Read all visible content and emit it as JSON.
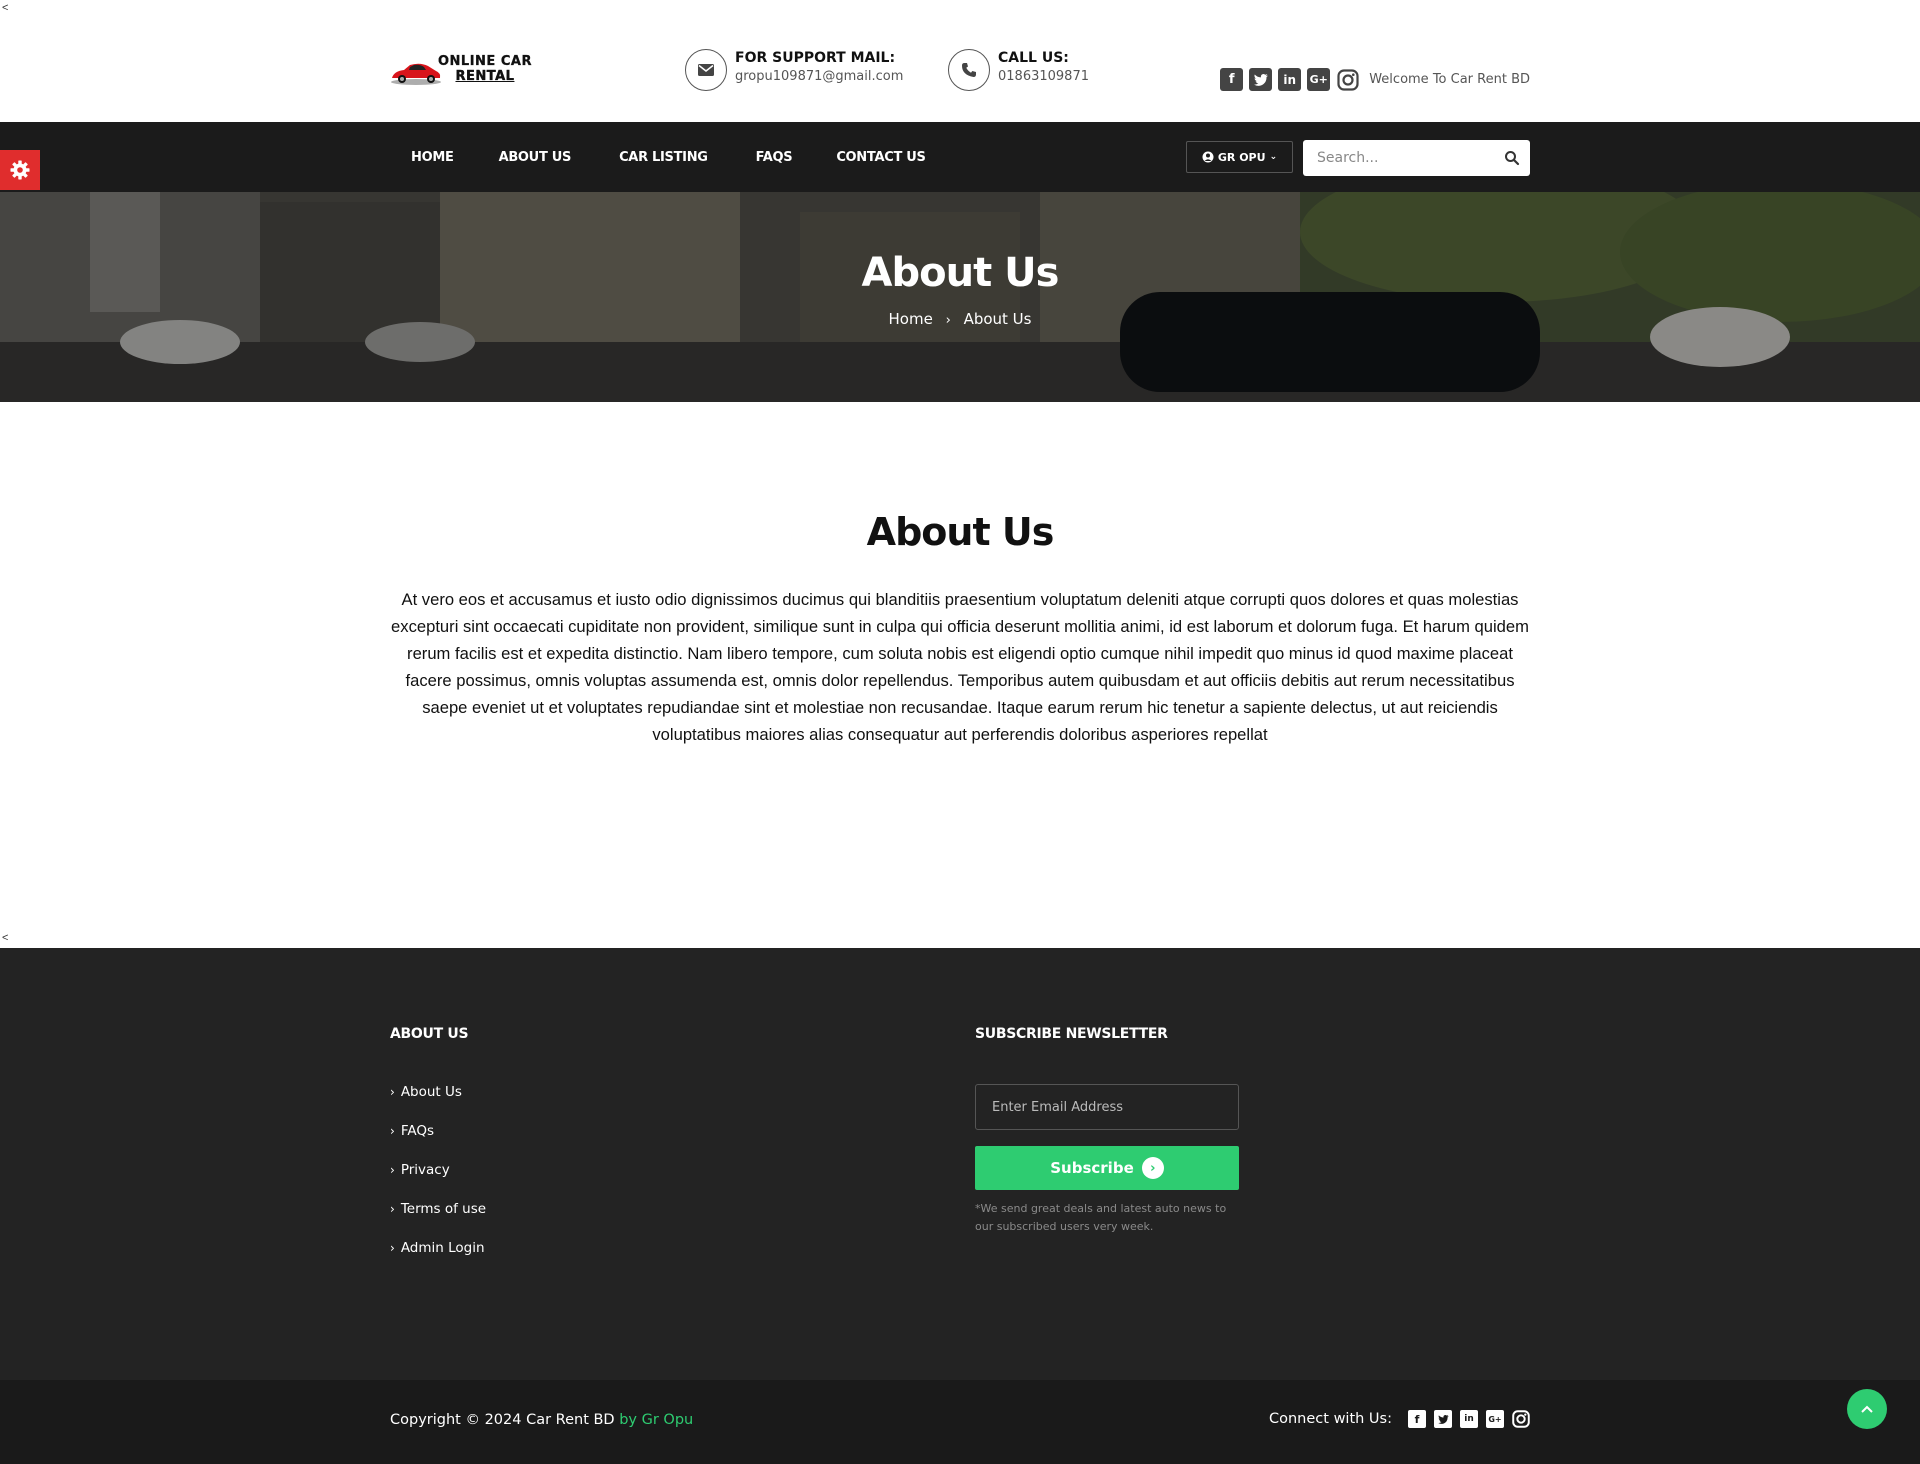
{
  "header": {
    "logo_line1": "ONLINE CAR",
    "logo_line2": "RENTAL",
    "support_label": "FOR SUPPORT MAIL:",
    "support_email": "gropu109871@gmail.com",
    "call_label": "CALL US:",
    "call_number": "01863109871",
    "social_icons": [
      "facebook-icon",
      "twitter-icon",
      "linkedin-icon",
      "google-plus-icon",
      "instagram-icon"
    ],
    "welcome": "Welcome To Car Rent BD"
  },
  "stray_glyph": "<",
  "nav": {
    "items": [
      {
        "label": "HOME"
      },
      {
        "label": "ABOUT US"
      },
      {
        "label": "CAR LISTING"
      },
      {
        "label": "FAQS"
      },
      {
        "label": "CONTACT US"
      }
    ],
    "user_label": "GR OPU",
    "search_placeholder": "Search..."
  },
  "banner": {
    "title": "About Us",
    "crumb_home": "Home",
    "crumb_current": "About Us"
  },
  "about": {
    "title": "About Us",
    "text": "At vero eos et accusamus et iusto odio dignissimos ducimus qui blanditiis praesentium voluptatum deleniti atque corrupti quos dolores et quas molestias excepturi sint occaecati cupiditate non provident, similique sunt in culpa qui officia deserunt mollitia animi, id est laborum et dolorum fuga. Et harum quidem rerum facilis est et expedita distinctio. Nam libero tempore, cum soluta nobis est eligendi optio cumque nihil impedit quo minus id quod maxime placeat facere possimus, omnis voluptas assumenda est, omnis dolor repellendus. Temporibus autem quibusdam et aut officiis debitis aut rerum necessitatibus saepe eveniet ut et voluptates repudiandae sint et molestiae non recusandae. Itaque earum rerum hic tenetur a sapiente delectus, ut aut reiciendis voluptatibus maiores alias consequatur aut perferendis doloribus asperiores repellat"
  },
  "footer": {
    "about_heading": "ABOUT US",
    "links": [
      "About Us",
      "FAQs",
      "Privacy",
      "Terms of use",
      "Admin Login"
    ],
    "newsletter_heading": "SUBSCRIBE NEWSLETTER",
    "email_placeholder": "Enter Email Address",
    "subscribe_label": "Subscribe",
    "note": "*We send great deals and latest auto news to our subscribed users very week.",
    "copyright": "Copyright © 2024 Car Rent BD",
    "by_text": "by Gr Opu",
    "connect_label": "Connect with Us:"
  },
  "colors": {
    "accent_green": "#2ecc71",
    "settings_red": "#e02d2d",
    "nav_bg": "#1b1b1b",
    "footer_bg": "#232323"
  }
}
